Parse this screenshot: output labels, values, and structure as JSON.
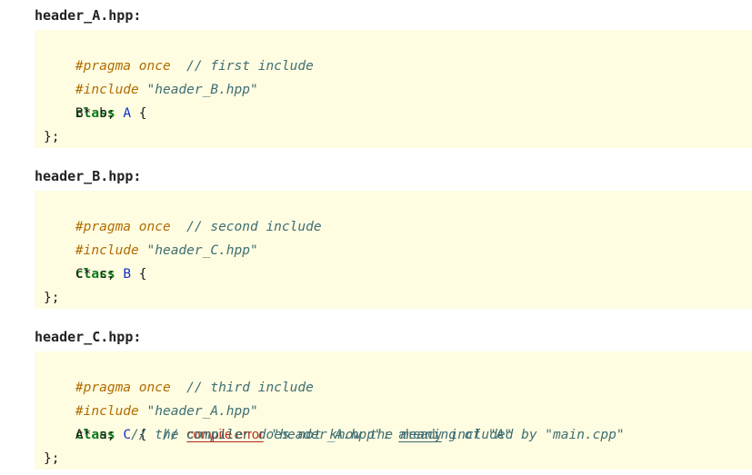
{
  "files": [
    {
      "name": "header_A.hpp:",
      "lines": [
        {
          "pragma": "#pragma once",
          "pragma_comment": "// first include"
        },
        {
          "include": "#include",
          "include_file": "\"header_B.hpp\""
        },
        {
          "keyword": "class",
          "class_name": "A",
          "brace": " {"
        },
        {
          "member": "B* b;"
        },
        {
          "close": "};"
        }
      ]
    },
    {
      "name": "header_B.hpp:",
      "lines": [
        {
          "pragma": "#pragma once",
          "pragma_comment": "// second include"
        },
        {
          "include": "#include",
          "include_file": "\"header_C.hpp\""
        },
        {
          "keyword": "class",
          "class_name": "B",
          "brace": " {"
        },
        {
          "member": "C* c;"
        },
        {
          "close": "};"
        }
      ]
    },
    {
      "name": "header_C.hpp:",
      "lines": [
        {
          "pragma": "#pragma once",
          "pragma_comment": "// third include"
        },
        {
          "include": "#include",
          "include_file": "\"header_A.hpp\""
        },
        {
          "keyword": "class",
          "class_name": "C",
          "brace": " {",
          "comment_prefix": "//",
          "error_text": "compile error",
          "comment_mid": "\"header_A.hpp\":",
          "underlined": "already",
          "comment_end": "included by \"main.cpp\""
        },
        {
          "member": "A* a;",
          "comment": "// the compiler does not know the meaning of \"A\""
        },
        {
          "close": "};"
        }
      ]
    }
  ]
}
